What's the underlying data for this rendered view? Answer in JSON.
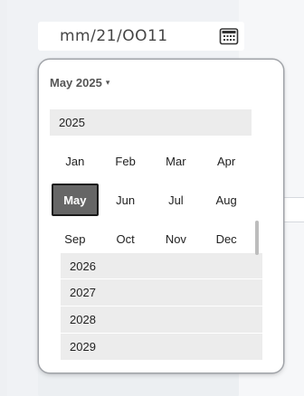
{
  "date_input": {
    "value": "mm/21/OO11",
    "icon": "calendar-icon"
  },
  "picker": {
    "header_label": "May 2025",
    "header_caret": "▾",
    "current_year": "2025",
    "months": [
      "Jan",
      "Feb",
      "Mar",
      "Apr",
      "May",
      "Jun",
      "Jul",
      "Aug",
      "Sep",
      "Oct",
      "Nov",
      "Dec"
    ],
    "selected_month": "May",
    "following_years": [
      "2026",
      "2027",
      "2028",
      "2029"
    ]
  },
  "colors": {
    "selected_bg": "#666666",
    "year_row_bg": "#ececec",
    "popup_border": "#a0a3a8"
  }
}
